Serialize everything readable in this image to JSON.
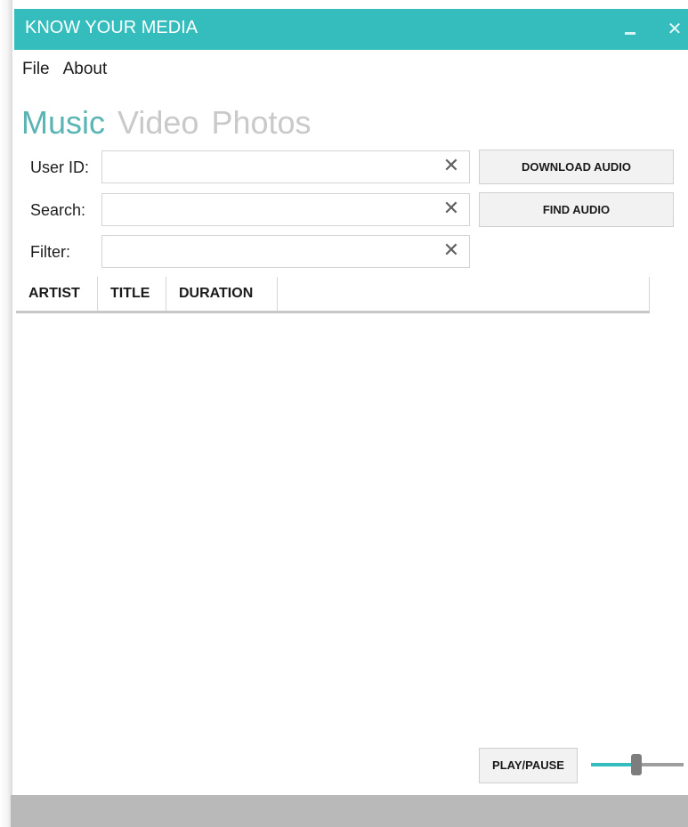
{
  "window": {
    "title": "KNOW YOUR MEDIA",
    "minimize_symbol": "–",
    "close_symbol": "✕",
    "accent_color": "#35bcbc"
  },
  "menu": {
    "items": [
      "File",
      "About"
    ]
  },
  "tabs": [
    {
      "label": "Music",
      "active": true
    },
    {
      "label": "Video",
      "active": false
    },
    {
      "label": "Photos",
      "active": false
    }
  ],
  "form": {
    "user_id": {
      "label": "User ID:",
      "value": ""
    },
    "search": {
      "label": "Search:",
      "value": ""
    },
    "filter": {
      "label": "Filter:",
      "value": ""
    },
    "clear_symbol": "✕",
    "download_button": "DOWNLOAD AUDIO",
    "find_button": "FIND AUDIO"
  },
  "table": {
    "columns": [
      "ARTIST",
      "TITLE",
      "DURATION"
    ],
    "rows": []
  },
  "player": {
    "play_pause_label": "PLAY/PAUSE",
    "volume_fraction": 0.47,
    "slider_fill_color": "#35bcbc"
  }
}
